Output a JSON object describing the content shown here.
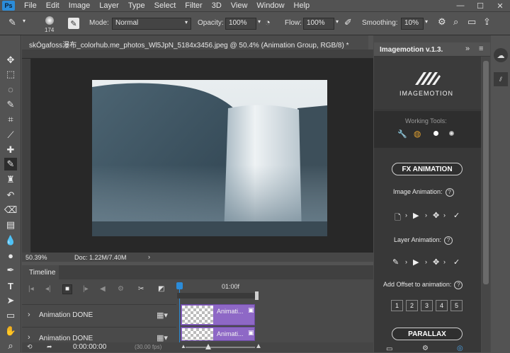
{
  "menubar": {
    "logo": "Ps",
    "items": [
      "File",
      "Edit",
      "Image",
      "Layer",
      "Type",
      "Select",
      "Filter",
      "3D",
      "View",
      "Window",
      "Help"
    ]
  },
  "options": {
    "brush_size": "174",
    "mode_label": "Mode:",
    "mode_value": "Normal",
    "opacity_label": "Opacity:",
    "opacity_value": "100%",
    "flow_label": "Flow:",
    "flow_value": "100%",
    "smoothing_label": "Smoothing:",
    "smoothing_value": "10%"
  },
  "document": {
    "tab_title": "skÓgafoss瀑布_colorhub.me_photos_Wl5JpN_5184x3456.jpeg @ 50.4% (Animation Group, RGB/8) *",
    "zoom": "50.39%",
    "doc_info": "Doc: 1.22M/7.40M"
  },
  "timeline": {
    "tab_label": "Timeline",
    "time_marker": "01:00f",
    "current_time": "0:00:00:00",
    "fps": "(30.00 fps)",
    "layers": [
      {
        "name": "Animation DONE",
        "clip_label": "Animati..."
      },
      {
        "name": "Animation DONE",
        "clip_label": "Animati..."
      }
    ]
  },
  "panel": {
    "title": "Imagemotion v.1.3.",
    "brand": "IMAGEMOTION",
    "working_tools_label": "Working Tools:",
    "fx_button": "FX ANIMATION",
    "image_animation_label": "Image Animation:",
    "layer_animation_label": "Layer Animation:",
    "offset_label": "Add Offset to animation:",
    "offset_values": [
      "1",
      "2",
      "3",
      "4",
      "5"
    ],
    "parallax_button": "PARALLAX",
    "help_glyph": "?"
  },
  "colors": {
    "accent_blue": "#2b8cd9",
    "clip_purple": "#8e68c6",
    "panel_dark": "#383838"
  }
}
